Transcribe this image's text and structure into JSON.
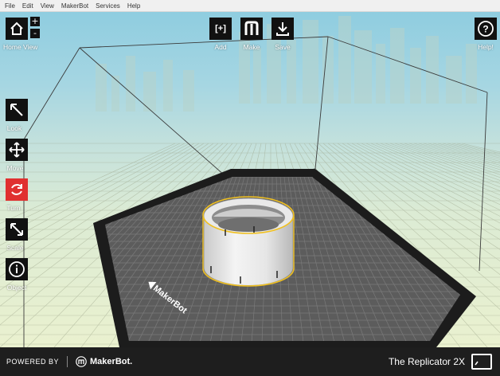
{
  "menu": [
    "File",
    "Edit",
    "View",
    "MakerBot",
    "Services",
    "Help"
  ],
  "toolbar": {
    "home_view": "Home View",
    "zoom_in": "+",
    "zoom_out": "-",
    "add": "Add",
    "add_symbol": "[+]",
    "make": "Make",
    "save": "Save",
    "help": "Help!"
  },
  "tools": {
    "look": "Look",
    "move": "Move",
    "turn": "Turn",
    "scale": "Scale",
    "object": "Object"
  },
  "active_tool": "turn",
  "plate_label": "MakerBot",
  "footer": {
    "powered_by": "POWERED BY",
    "brand": "MakerBot.",
    "printer": "The Replicator 2X"
  },
  "colors": {
    "active_tool": "#e03030",
    "selection": "#f0c020",
    "plate": "#5a5a5a"
  }
}
